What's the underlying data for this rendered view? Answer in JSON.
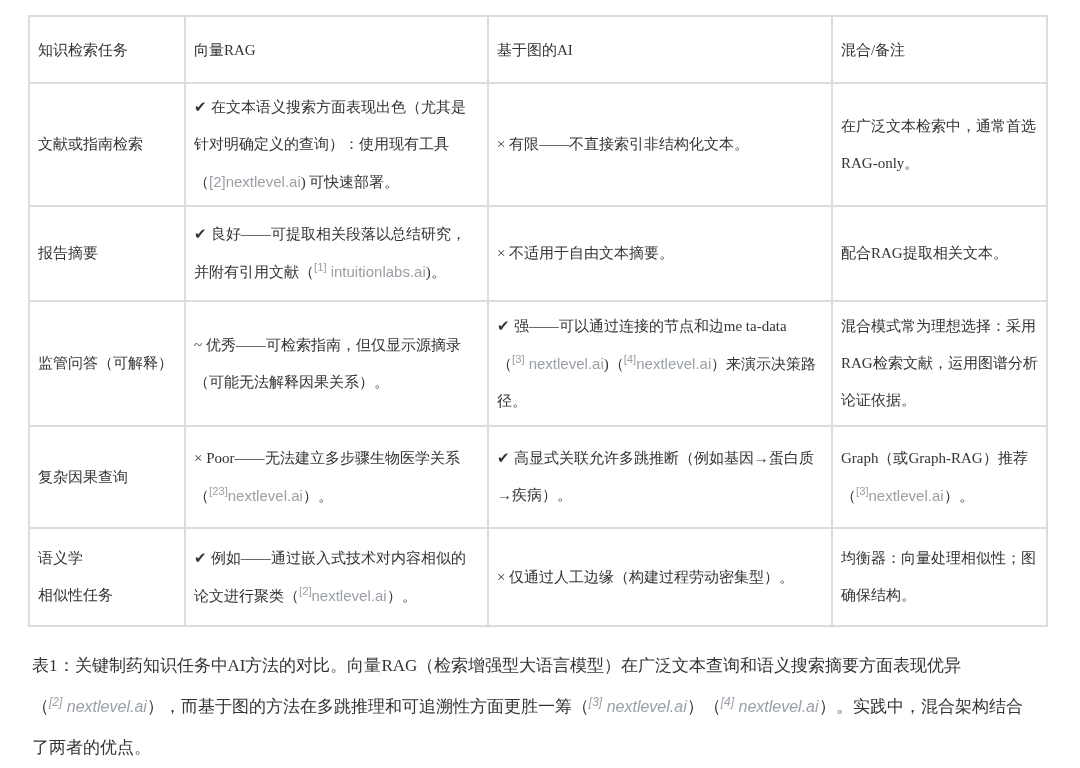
{
  "table": {
    "columns": [
      "知识检索任务",
      "向量RAG",
      "基于图的AI",
      "混合/备注"
    ],
    "rows": [
      {
        "cells": [
          [
            {
              "kind": "text",
              "text": "文献或指南检索"
            }
          ],
          [
            {
              "kind": "text",
              "text": "✔ 在文本语义搜索方面表现出色（尤其是针对明确定义的查询）：使用现有工具（"
            },
            {
              "kind": "cite",
              "text": "[2]nextlevel.ai"
            },
            {
              "kind": "text",
              "text": ") 可快速部署。"
            }
          ],
          [
            {
              "kind": "text",
              "text": "× 有限——不直接索引非结构化文本。"
            }
          ],
          [
            {
              "kind": "text",
              "text": "在广泛文本检索中，通常首选RAG-only。"
            }
          ]
        ]
      },
      {
        "cells": [
          [
            {
              "kind": "text",
              "text": "报告摘要"
            }
          ],
          [
            {
              "kind": "text",
              "text": "✔ 良好——可提取相关段落以总结研究，并附有引用文献（"
            },
            {
              "kind": "cite",
              "text": "$^{[1]}$ intuitionlabs.ai"
            },
            {
              "kind": "text",
              "text": ")。"
            }
          ],
          [
            {
              "kind": "text",
              "text": "× 不适用于自由文本摘要。"
            }
          ],
          [
            {
              "kind": "text",
              "text": "配合RAG提取相关文本。"
            }
          ]
        ]
      },
      {
        "cells": [
          [
            {
              "kind": "text",
              "text": "监管问答（可解释）"
            }
          ],
          [
            {
              "kind": "text",
              "text": "~ 优秀——可检索指南，但仅显示源摘录（可能无法解释因果关系）。"
            }
          ],
          [
            {
              "kind": "text",
              "text": "✔ 强——可以通过连接的节点和边me ta-data（"
            },
            {
              "kind": "cite",
              "text": "$^{[3]}$ nextlevel.ai"
            },
            {
              "kind": "text",
              "text": ")（"
            },
            {
              "kind": "cite",
              "text": "$^{[4]}$nextlevel.ai"
            },
            {
              "kind": "text",
              "text": "）来演示决策路径。"
            }
          ],
          [
            {
              "kind": "text",
              "text": "混合模式常为理想选择：采用RAG检索文献，运用图谱分析论证依据。"
            }
          ]
        ]
      },
      {
        "cells": [
          [
            {
              "kind": "text",
              "text": "复杂因果查询"
            }
          ],
          [
            {
              "kind": "text",
              "text": "× Poor——无法建立多步骤生物医学关系（"
            },
            {
              "kind": "cite",
              "text": "$^{[23]}$nextlevel.ai"
            },
            {
              "kind": "text",
              "text": "）。"
            }
          ],
          [
            {
              "kind": "text",
              "text": "✔ 高显式关联允许多跳推断（例如基因→蛋白质→疾病）。"
            }
          ],
          [
            {
              "kind": "text",
              "text": "Graph（或Graph-RAG）推荐（"
            },
            {
              "kind": "cite",
              "text": "$^{[3]}$nextlevel.ai"
            },
            {
              "kind": "text",
              "text": "）。"
            }
          ]
        ]
      },
      {
        "cells": [
          [
            {
              "kind": "line",
              "text": "语义学"
            },
            {
              "kind": "line",
              "text": "相似性任务"
            }
          ],
          [
            {
              "kind": "text",
              "text": "✔ 例如——通过嵌入式技术对内容相似的论文进行聚类（"
            },
            {
              "kind": "cite",
              "text": "$^{[2]}$nextlevel.ai"
            },
            {
              "kind": "text",
              "text": "）。"
            }
          ],
          [
            {
              "kind": "text",
              "text": "× 仅通过人工边缘（构建过程劳动密集型）。"
            }
          ],
          [
            {
              "kind": "text",
              "text": "均衡器：向量处理相似性；图确保结构。"
            }
          ]
        ]
      }
    ]
  },
  "caption": [
    {
      "kind": "text",
      "text": "表1：关键制药知识任务中AI方法的对比。向量RAG（检索增强型大语言模型）在广泛文本查询和语义搜索摘要方面表现优异（"
    },
    {
      "kind": "cite",
      "text": "$^{[2]}$ nextlevel.ai"
    },
    {
      "kind": "text",
      "text": "），而基于图的方法在多跳推理和可追溯性方面更胜一筹（"
    },
    {
      "kind": "cite",
      "text": "$^{[3]}$ nextlevel.ai"
    },
    {
      "kind": "text",
      "text": "）（"
    },
    {
      "kind": "cite",
      "text": "$^{[4]}$ nextlevel.ai"
    },
    {
      "kind": "text",
      "text": "）。实践中，混合架构结合了两者的优点。"
    }
  ]
}
